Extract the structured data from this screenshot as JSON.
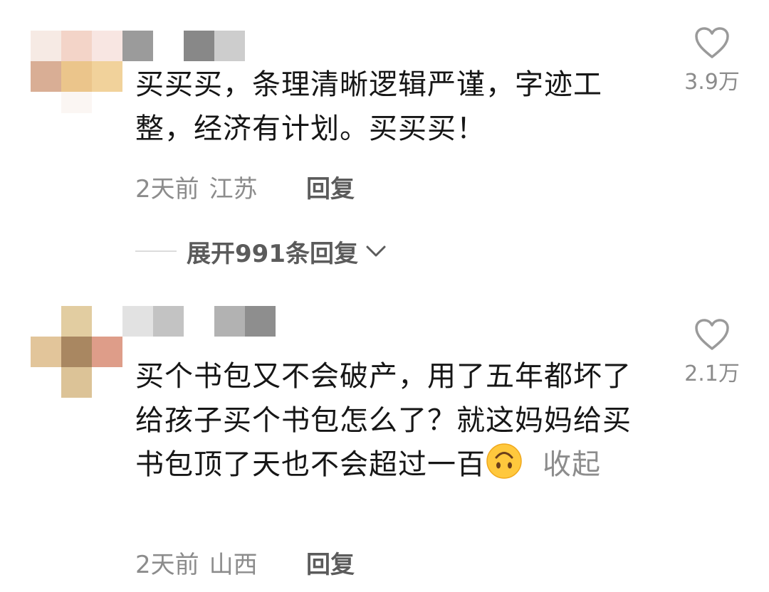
{
  "comments": [
    {
      "text": "买买买，条理清晰逻辑严谨，字迹工整，经济有计划。买买买！",
      "time": "2天前",
      "location": "江苏",
      "reply_label": "回复",
      "likes": "3.9万",
      "expand_replies": "展开991条回复"
    },
    {
      "text": "买个书包又不会破产，用了五年都坏了给孩子买个书包怎么了？就这妈妈给买书包顶了天也不会超过一百",
      "emoji": "upside-down-face",
      "collapse_label": "收起",
      "time": "2天前",
      "location": "山西",
      "reply_label": "回复",
      "likes": "2.1万"
    }
  ],
  "colors": {
    "text": "#161616",
    "meta": "#8c8c8c",
    "action": "#5b5b5b",
    "heart": "#9a9a9a"
  }
}
